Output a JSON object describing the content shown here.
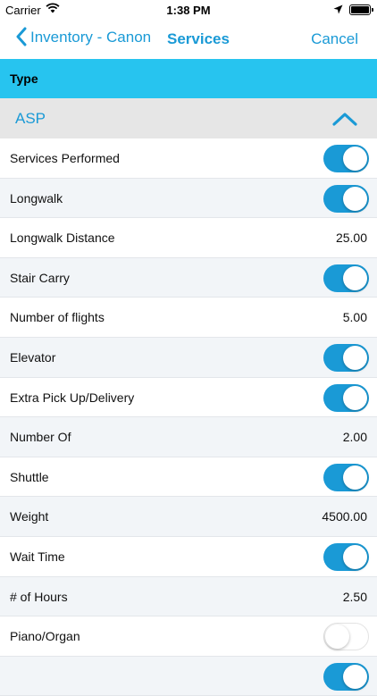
{
  "status_bar": {
    "carrier": "Carrier",
    "time": "1:38 PM"
  },
  "nav": {
    "back_label": "Inventory - Canon",
    "title": "Services",
    "cancel_label": "Cancel"
  },
  "type_header": "Type",
  "section": {
    "label": "ASP",
    "expanded": true
  },
  "colors": {
    "accent": "#1a9ad6",
    "type_header_bg": "#27c4ef",
    "section_bg": "#e6e6e6",
    "alt_row_bg": "#f2f5f8"
  },
  "rows": [
    {
      "label": "Services Performed",
      "kind": "toggle",
      "on": true
    },
    {
      "label": "Longwalk",
      "kind": "toggle",
      "on": true
    },
    {
      "label": "Longwalk Distance",
      "kind": "value",
      "value": "25.00"
    },
    {
      "label": "Stair Carry",
      "kind": "toggle",
      "on": true
    },
    {
      "label": "Number of flights",
      "kind": "value",
      "value": "5.00"
    },
    {
      "label": "Elevator",
      "kind": "toggle",
      "on": true
    },
    {
      "label": "Extra Pick Up/Delivery",
      "kind": "toggle",
      "on": true
    },
    {
      "label": "Number Of",
      "kind": "value",
      "value": "2.00"
    },
    {
      "label": "Shuttle",
      "kind": "toggle",
      "on": true
    },
    {
      "label": "Weight",
      "kind": "value",
      "value": "4500.00"
    },
    {
      "label": "Wait Time",
      "kind": "toggle",
      "on": true
    },
    {
      "label": "# of Hours",
      "kind": "value",
      "value": "2.50"
    },
    {
      "label": "Piano/Organ",
      "kind": "toggle",
      "on": false
    },
    {
      "label": "",
      "kind": "toggle",
      "on": true
    }
  ]
}
